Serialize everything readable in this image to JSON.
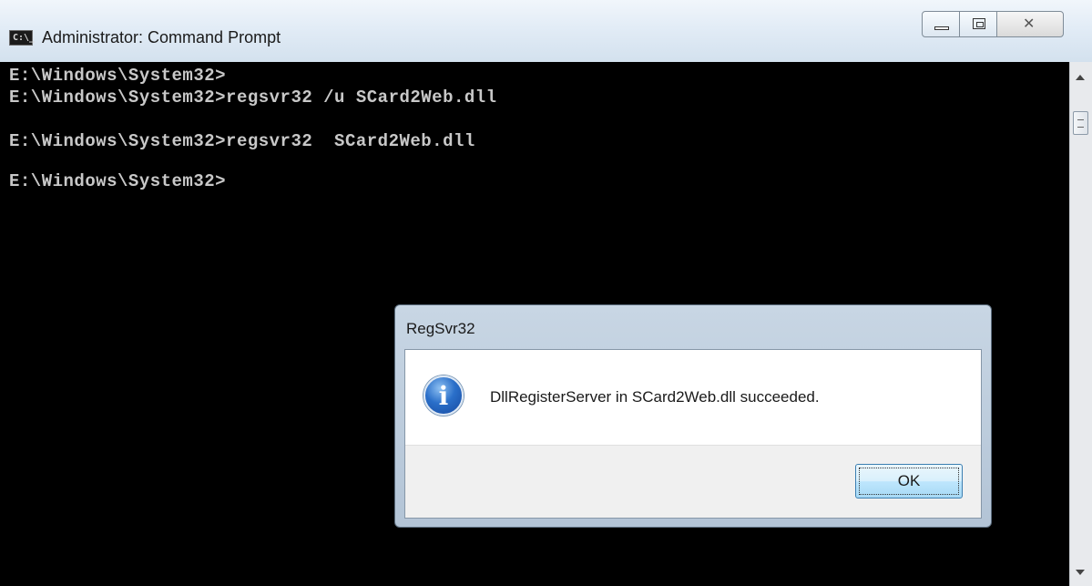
{
  "window": {
    "title": "Administrator: Command Prompt",
    "icon_label": "C:\\_",
    "icon": "console-icon",
    "buttons": [
      "minimize",
      "maximize",
      "close"
    ]
  },
  "console": {
    "lines": [
      "E:\\Windows\\System32>",
      "E:\\Windows\\System32>regsvr32 /u SCard2Web.dll",
      "E:\\Windows\\System32>regsvr32  SCard2Web.dll",
      "E:\\Windows\\System32>"
    ],
    "colors": {
      "background": "#000000",
      "text": "#c8c8c8"
    }
  },
  "dialog": {
    "title": "RegSvr32",
    "icon": "info-icon",
    "message": "DllRegisterServer in SCard2Web.dll succeeded.",
    "ok_label": "OK"
  }
}
